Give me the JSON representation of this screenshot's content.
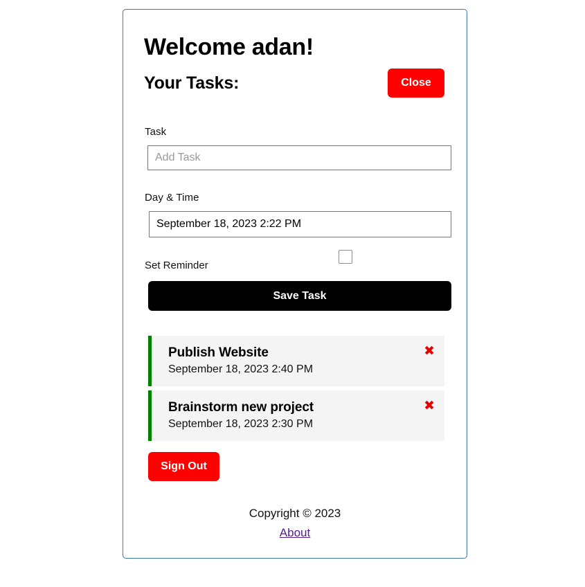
{
  "app": {
    "border_color": "#3d7ab0",
    "accent_red": "#ff0000",
    "accent_green": "#008000",
    "card_bg": "#f4f4f4",
    "link_color": "#551a8b"
  },
  "header": {
    "welcome": "Welcome adan!",
    "tasks_heading": "Your Tasks:",
    "close_label": "Close"
  },
  "form": {
    "task_label": "Task",
    "task_placeholder": "Add Task",
    "task_value": "",
    "daytime_label": "Day & Time",
    "daytime_value": "September 18, 2023 2:22 PM",
    "daytime_placeholder": "Day & Time",
    "reminder_label": "Set Reminder",
    "reminder_checked": false,
    "save_label": "Save Task"
  },
  "tasks": [
    {
      "title": "Publish Website",
      "time": "September 18, 2023 2:40 PM",
      "delete_icon": "✖"
    },
    {
      "title": "Brainstorm new project",
      "time": "September 18, 2023 2:30 PM",
      "delete_icon": "✖"
    }
  ],
  "actions": {
    "signout_label": "Sign Out"
  },
  "footer": {
    "copyright": "Copyright © 2023",
    "about_label": "About"
  }
}
